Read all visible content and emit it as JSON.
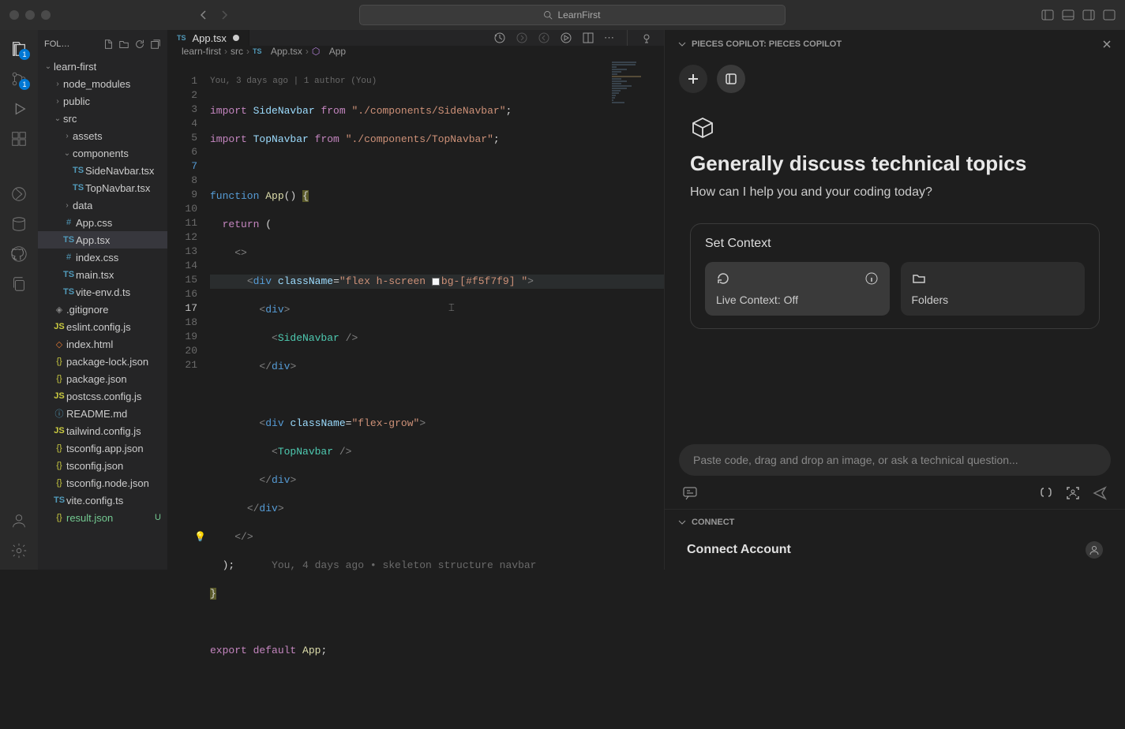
{
  "titlebar": {
    "title": "LearnFirst"
  },
  "sidebar": {
    "header": "FOL…",
    "root": "learn-first",
    "folders": {
      "node_modules": "node_modules",
      "public": "public",
      "src": "src",
      "assets": "assets",
      "components": "components",
      "data": "data"
    },
    "files": {
      "side_navbar": "SideNavbar.tsx",
      "top_navbar": "TopNavbar.tsx",
      "app_css": "App.css",
      "app_tsx": "App.tsx",
      "index_css": "index.css",
      "main_tsx": "main.tsx",
      "vite_env": "vite-env.d.ts",
      "gitignore": ".gitignore",
      "eslint": "eslint.config.js",
      "index_html": "index.html",
      "pkg_lock": "package-lock.json",
      "pkg": "package.json",
      "postcss": "postcss.config.js",
      "readme": "README.md",
      "tailwind": "tailwind.config.js",
      "tsc_app": "tsconfig.app.json",
      "tsc": "tsconfig.json",
      "tsc_node": "tsconfig.node.json",
      "vite_cfg": "vite.config.ts",
      "result": "result.json"
    },
    "tag_u": "U"
  },
  "tab": {
    "label": "App.tsx"
  },
  "breadcrumb": {
    "p1": "learn-first",
    "p2": "src",
    "p3": "App.tsx",
    "p4": "App"
  },
  "blame_top": "You, 3 days ago | 1 author (You)",
  "blame_inline": "You, 4 days ago • skeleton structure navbar",
  "code": {
    "l1a": "import",
    "l1b": "SideNavbar",
    "l1c": "from",
    "l1d": "\"./components/SideNavbar\"",
    "l2a": "import",
    "l2b": "TopNavbar",
    "l2c": "from",
    "l2d": "\"./components/TopNavbar\"",
    "l4a": "function",
    "l4b": "App",
    "l4c": "()",
    "l5a": "return",
    "l7a": "div",
    "l7b": "className",
    "l7c": "\"flex h-screen ",
    "l7c2": "bg-[#f5f7f9] \"",
    "l8": "div",
    "l9": "SideNavbar",
    "l12a": "div",
    "l12b": "className",
    "l12c": "\"flex-grow\"",
    "l13": "TopNavbar",
    "l20a": "export",
    "l20b": "default",
    "l20c": "App"
  },
  "pieces": {
    "header": "PIECES COPILOT: PIECES COPILOT",
    "title": "Generally discuss technical topics",
    "subtitle": "How can I help you and your coding today?",
    "context_title": "Set Context",
    "live_context": "Live Context: Off",
    "folders": "Folders",
    "placeholder": "Paste code, drag and drop an image, or ask a technical question...",
    "connect_header": "CONNECT",
    "connect_account": "Connect Account"
  },
  "activity_badges": {
    "explorer": "1",
    "scm": "1"
  }
}
